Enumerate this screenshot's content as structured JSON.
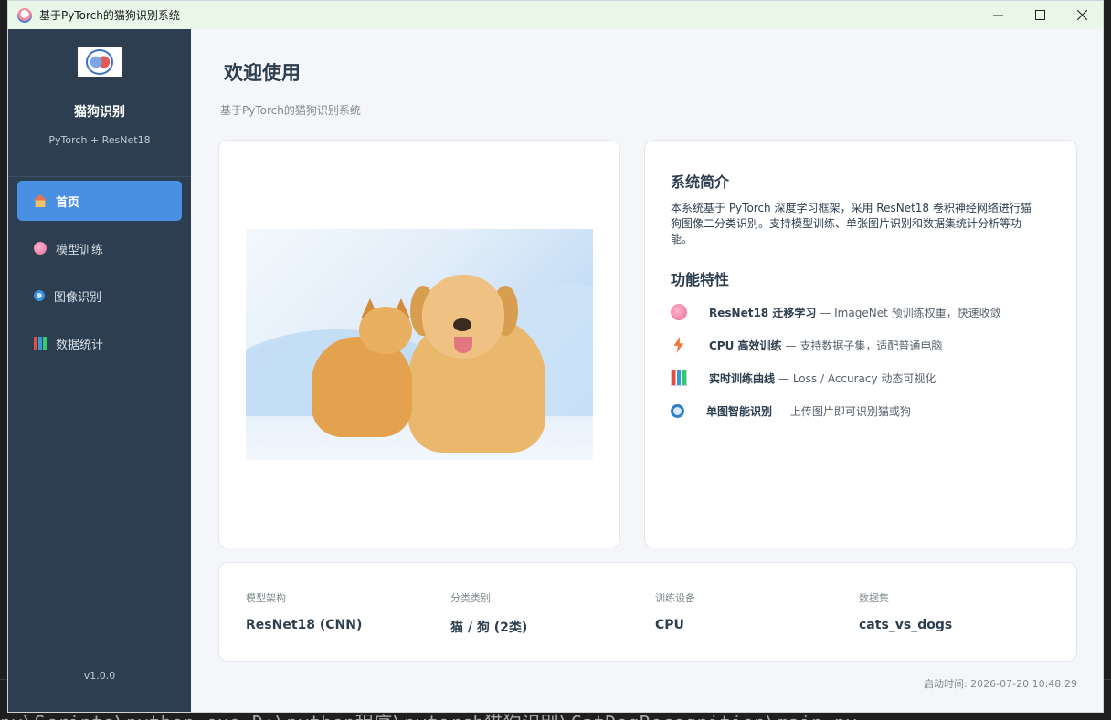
{
  "window": {
    "title": "基于PyTorch的猫狗识别系统",
    "controls": {
      "minimize": "minimize-icon",
      "maximize": "maximize-icon",
      "close": "close-icon"
    }
  },
  "terminal": {
    "line": "py\\Scripts\\python.exe D:\\python程序\\pytorch猫狗识别\\CatDogRecognition\\main.py"
  },
  "sidebar": {
    "brand_name": "猫狗识别",
    "brand_sub": "PyTorch + ResNet18",
    "items": [
      {
        "label": "首页",
        "icon": "home-icon",
        "active": true
      },
      {
        "label": "模型训练",
        "icon": "brain-icon",
        "active": false
      },
      {
        "label": "图像识别",
        "icon": "magnifier-icon",
        "active": false
      },
      {
        "label": "数据统计",
        "icon": "bar-chart-icon",
        "active": false
      }
    ],
    "version": "v1.0.0"
  },
  "main": {
    "title": "欢迎使用",
    "subtitle": "基于PyTorch的猫狗识别系统",
    "intro": {
      "title": "系统简介",
      "description": "本系统基于 PyTorch 深度学习框架，采用 ResNet18 卷积神经网络进行猫狗图像二分类识别。支持模型训练、单张图片识别和数据集统计分析等功能。"
    },
    "features": {
      "title": "功能特性",
      "items": [
        {
          "icon": "brain-icon",
          "name": "ResNet18 迁移学习",
          "detail": "— ImageNet 预训练权重，快速收敛"
        },
        {
          "icon": "lightning-icon",
          "name": "CPU 高效训练",
          "detail": "— 支持数据子集，适配普通电脑"
        },
        {
          "icon": "bar-chart-icon",
          "name": "实时训练曲线",
          "detail": "— Loss / Accuracy 动态可视化"
        },
        {
          "icon": "magnifier-icon",
          "name": "单图智能识别",
          "detail": "— 上传图片即可识别猫或狗"
        }
      ]
    },
    "info": [
      {
        "label": "模型架构",
        "value": "ResNet18 (CNN)"
      },
      {
        "label": "分类类别",
        "value": "猫 / 狗 (2类)"
      },
      {
        "label": "训练设备",
        "value": "CPU"
      },
      {
        "label": "数据集",
        "value": "cats_vs_dogs"
      }
    ],
    "start_time": "启动时间: 2026-07-20 10:48:29"
  },
  "colors": {
    "sidebar_bg": "#2c3e50",
    "active_item": "#4a90e2",
    "titlebar_bg": "#e9f7e9",
    "main_bg": "#f5f6fa"
  }
}
